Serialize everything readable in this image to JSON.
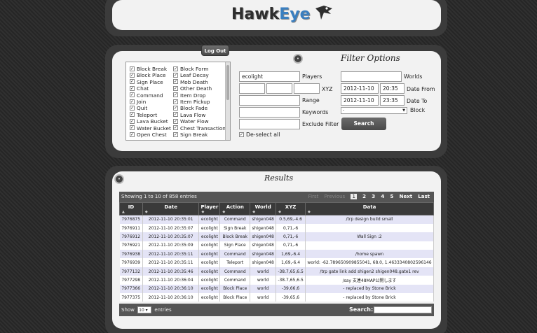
{
  "header": {
    "logo_main": "Hawk",
    "logo_accent": "Eye"
  },
  "filter": {
    "logout_label": "Log Out",
    "title": "Filter Options",
    "actions": [
      {
        "label": "Block Break",
        "checked": true
      },
      {
        "label": "Block Place",
        "checked": true
      },
      {
        "label": "Sign Place",
        "checked": true
      },
      {
        "label": "Chat",
        "checked": true
      },
      {
        "label": "Command",
        "checked": true
      },
      {
        "label": "Join",
        "checked": true
      },
      {
        "label": "Quit",
        "checked": true
      },
      {
        "label": "Teleport",
        "checked": true
      },
      {
        "label": "Lava Bucket",
        "checked": true
      },
      {
        "label": "Water Bucket",
        "checked": true
      },
      {
        "label": "Open Chest",
        "checked": true
      },
      {
        "label": "Block Form",
        "checked": true
      },
      {
        "label": "Leaf Decay",
        "checked": true
      },
      {
        "label": "Mob Death",
        "checked": true
      },
      {
        "label": "Other Death",
        "checked": true
      },
      {
        "label": "Item Drop",
        "checked": true
      },
      {
        "label": "Item Pickup",
        "checked": true
      },
      {
        "label": "Block Fade",
        "checked": true
      },
      {
        "label": "Lava Flow",
        "checked": true
      },
      {
        "label": "Water Flow",
        "checked": true
      },
      {
        "label": "Chest Transaction",
        "checked": true
      },
      {
        "label": "Sign Break",
        "checked": true
      }
    ],
    "players_value": "ecolight",
    "players_label": "Players",
    "xyz_label": "XYZ",
    "range_label": "Range",
    "keywords_label": "Keywords",
    "exclude_label": "Exclude Filter",
    "deselect_label": "De-select all",
    "worlds_label": "Worlds",
    "date_from": "2012-11-10",
    "time_from": "20:35",
    "date_from_label": "Date From",
    "date_to": "2012-11-10",
    "time_to": "23:35",
    "date_to_label": "Date To",
    "block_select": "-",
    "block_label": "Block",
    "search_label": "Search"
  },
  "results": {
    "title": "Results",
    "info": "Showing 1 to 10 of 858 entries",
    "pager": {
      "first": "First",
      "previous": "Previous",
      "current": "1",
      "pages": [
        "2",
        "3",
        "4",
        "5"
      ],
      "next": "Next",
      "last": "Last"
    },
    "columns": [
      "ID",
      "Date",
      "Player",
      "Action",
      "World",
      "XYZ",
      "Data"
    ],
    "rows": [
      [
        "7976875",
        "2012-11-10 20:35:01",
        "ecolight",
        "Command",
        "shigen048",
        "0.5,69,-4.6",
        "/trp design build small"
      ],
      [
        "7976911",
        "2012-11-10 20:35:07",
        "ecolight",
        "Sign Break",
        "shigen048",
        "0,71,-6",
        ""
      ],
      [
        "7976912",
        "2012-11-10 20:35:07",
        "ecolight",
        "Block Break",
        "shigen048",
        "0,71,-6",
        "Wall Sign :2"
      ],
      [
        "7976921",
        "2012-11-10 20:35:09",
        "ecolight",
        "Sign Place",
        "shigen048",
        "0,71,-6",
        ""
      ],
      [
        "7976938",
        "2012-11-10 20:35:11",
        "ecolight",
        "Command",
        "shigen048",
        "1,69,-6.4",
        "/home spawn"
      ],
      [
        "7976939",
        "2012-11-10 20:35:11",
        "ecolight",
        "Teleport",
        "shigen048",
        "1,69,-6.4",
        "world: -62.789650909855041, 68.0, 1.4633340802596146"
      ],
      [
        "7977132",
        "2012-11-10 20:35:46",
        "ecolight",
        "Command",
        "world",
        "-38.7,65,6.5",
        "/trp gate link add shigen2 shigen048.gate1 rev"
      ],
      [
        "7977298",
        "2012-11-10 20:36:04",
        "ecolight",
        "Command",
        "world",
        "-38.7,65,6.5",
        "/say 支連48MAP公開します"
      ],
      [
        "7977366",
        "2012-11-10 20:36:10",
        "ecolight",
        "Block Place",
        "world",
        "-39,66,6",
        "- replaced by Stone Brick"
      ],
      [
        "7977375",
        "2012-11-10 20:36:10",
        "ecolight",
        "Block Place",
        "world",
        "-39,65,6",
        "- replaced by Stone Brick"
      ]
    ],
    "show_label": "Show",
    "show_value": "10",
    "entries_label": "entries",
    "search_label": "Search:"
  }
}
